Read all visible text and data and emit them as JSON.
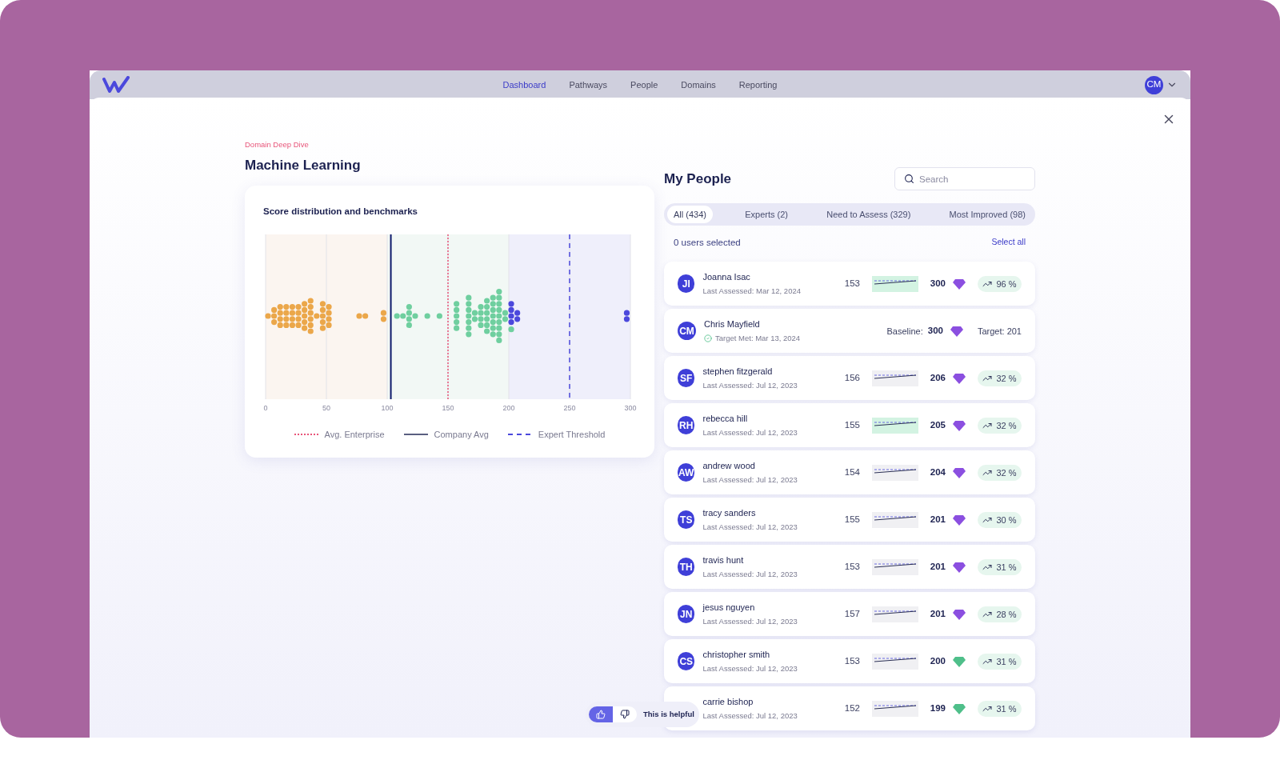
{
  "nav": {
    "items": [
      {
        "label": "Dashboard",
        "selected": true
      },
      {
        "label": "Pathways",
        "selected": false
      },
      {
        "label": "People",
        "selected": false
      },
      {
        "label": "Domains",
        "selected": false
      },
      {
        "label": "Reporting",
        "selected": false
      }
    ],
    "user_initials": "CM"
  },
  "page": {
    "eyebrow": "Domain Deep Dive",
    "title": "Machine Learning"
  },
  "chart_card": {
    "title": "Score distribution and benchmarks",
    "axis_ticks": [
      "0",
      "50",
      "100",
      "150",
      "200",
      "250",
      "300"
    ],
    "legend": [
      {
        "kind": "dotted",
        "label": "Avg. Enterprise",
        "color": "#e8557a"
      },
      {
        "kind": "solid",
        "label": "Company Avg",
        "color": "#5a5f80"
      },
      {
        "kind": "dashed",
        "label": "Expert Threshold",
        "color": "#4b48dc"
      }
    ]
  },
  "people": {
    "title": "My People",
    "search": {
      "placeholder": "Search"
    },
    "tabs": [
      {
        "label": "All (434)",
        "selected": true
      },
      {
        "label": "Experts (2)",
        "selected": false
      },
      {
        "label": "Need to Assess (329)",
        "selected": false
      },
      {
        "label": "Most Improved (98)",
        "selected": false
      }
    ],
    "selection_text": "0 users selected",
    "select_all": "Select all",
    "rows": [
      {
        "kind": "progress",
        "initials": "JI",
        "name": "Joanna Isac",
        "detail": "Last Assessed: Mar 12, 2024",
        "baseline": "153",
        "highlighted": true,
        "score": "300",
        "color": "#8b4fe0",
        "trend": "96 %"
      },
      {
        "kind": "target",
        "initials": "CM",
        "name": "Chris Mayfield",
        "detail": "Target Met: Mar 13, 2024",
        "baseline_label": "Baseline:",
        "score": "300",
        "color": "#8b4fe0",
        "target": "Target: 201"
      },
      {
        "kind": "progress",
        "initials": "SF",
        "name": "stephen fitzgerald",
        "detail": "Last Assessed: Jul 12, 2023",
        "baseline": "156",
        "highlighted": false,
        "score": "206",
        "color": "#8b4fe0",
        "trend": "32 %"
      },
      {
        "kind": "progress",
        "initials": "RH",
        "name": "rebecca hill",
        "detail": "Last Assessed: Jul 12, 2023",
        "baseline": "155",
        "highlighted": true,
        "score": "205",
        "color": "#8b4fe0",
        "trend": "32 %"
      },
      {
        "kind": "progress",
        "initials": "AW",
        "name": "andrew wood",
        "detail": "Last Assessed: Jul 12, 2023",
        "baseline": "154",
        "highlighted": false,
        "score": "204",
        "color": "#8b4fe0",
        "trend": "32 %"
      },
      {
        "kind": "progress",
        "initials": "TS",
        "name": "tracy sanders",
        "detail": "Last Assessed: Jul 12, 2023",
        "baseline": "155",
        "highlighted": false,
        "score": "201",
        "color": "#8b4fe0",
        "trend": "30 %"
      },
      {
        "kind": "progress",
        "initials": "TH",
        "name": "travis hunt",
        "detail": "Last Assessed: Jul 12, 2023",
        "baseline": "153",
        "highlighted": false,
        "score": "201",
        "color": "#8b4fe0",
        "trend": "31 %"
      },
      {
        "kind": "progress",
        "initials": "JN",
        "name": "jesus nguyen",
        "detail": "Last Assessed: Jul 12, 2023",
        "baseline": "157",
        "highlighted": false,
        "score": "201",
        "color": "#8b4fe0",
        "trend": "28 %"
      },
      {
        "kind": "progress",
        "initials": "CS",
        "name": "christopher smith",
        "detail": "Last Assessed: Jul 12, 2023",
        "baseline": "153",
        "highlighted": false,
        "score": "200",
        "color": "#4fbf8a",
        "trend": "31 %"
      },
      {
        "kind": "progress",
        "name": "carrie bishop",
        "detail": "Last Assessed: Jul 12, 2023",
        "baseline": "152",
        "highlighted": false,
        "score": "199",
        "color": "#4fbf8a",
        "trend": "31 %"
      }
    ]
  },
  "feedback": {
    "thumbs_up_selected": true,
    "thumbs_down_selected": false,
    "label": "This is helpful"
  }
}
